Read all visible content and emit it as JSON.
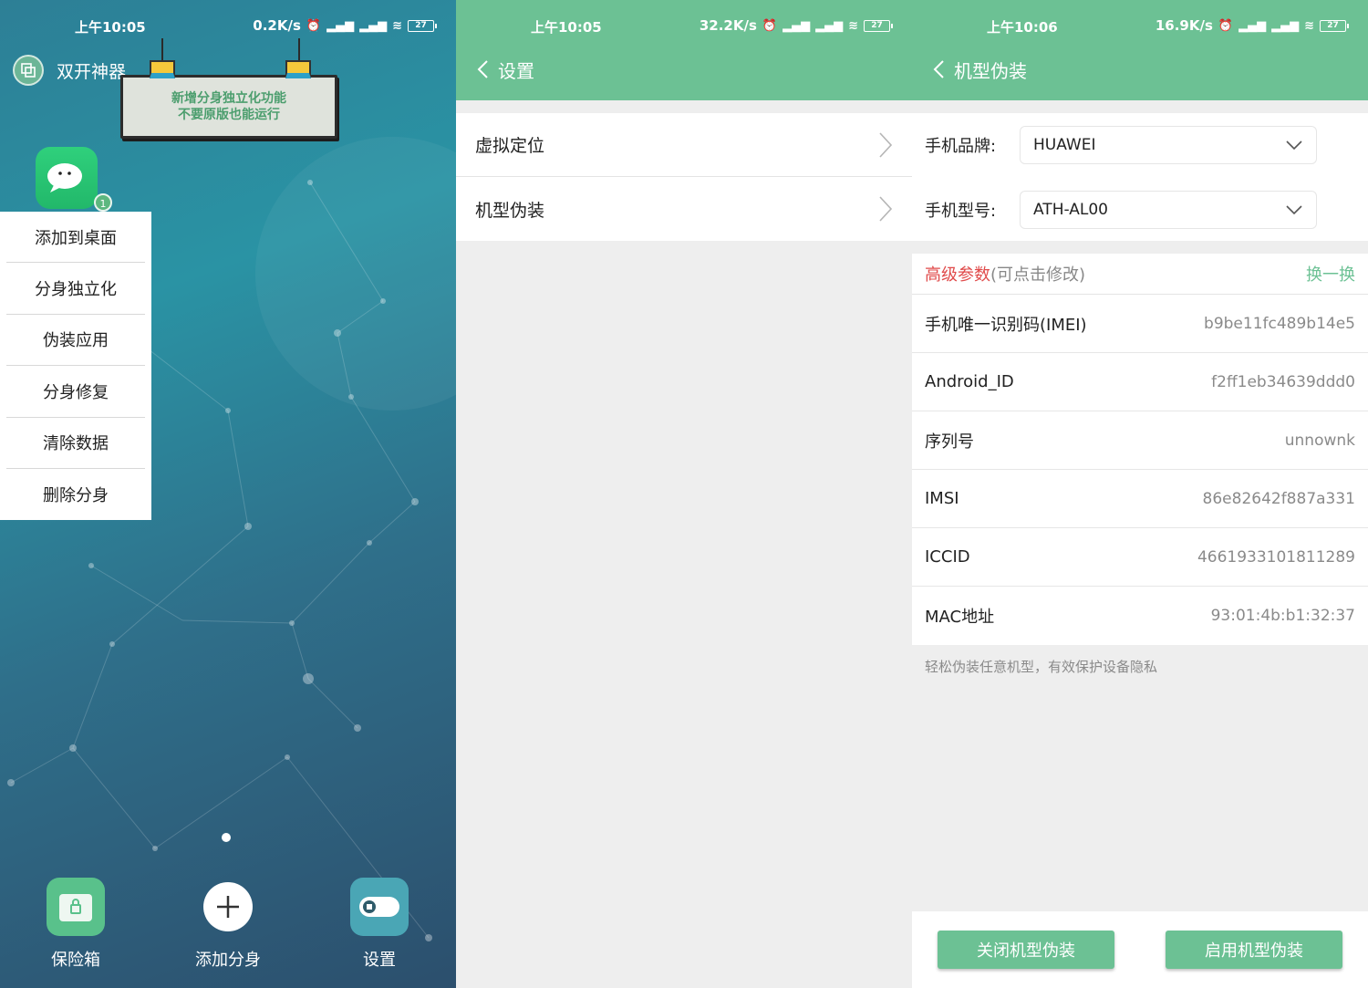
{
  "panel_home": {
    "status": {
      "time": "上午10:05",
      "net_speed": "0.2K/s",
      "battery": "27"
    },
    "brand": "双开神器",
    "banner": {
      "line1": "新增分身独立化功能",
      "line2": "不要原版也能运行"
    },
    "app_badge": "1",
    "context_menu": [
      "添加到桌面",
      "分身独立化",
      "伪装应用",
      "分身修复",
      "清除数据",
      "删除分身"
    ],
    "dock": [
      {
        "label": "保险箱",
        "icon": "lock-icon",
        "color": "#59c18b"
      },
      {
        "label": "添加分身",
        "icon": "plus-icon",
        "color": "#ffffff"
      },
      {
        "label": "设置",
        "icon": "toggle-icon",
        "color": "#4aa6b5"
      }
    ]
  },
  "panel_settings": {
    "status": {
      "time": "上午10:05",
      "net_speed": "32.2K/s",
      "battery": "27"
    },
    "title": "设置",
    "items": [
      "虚拟定位",
      "机型伪装"
    ]
  },
  "panel_device": {
    "status": {
      "time": "上午10:06",
      "net_speed": "16.9K/s",
      "battery": "27"
    },
    "title": "机型伪装",
    "brand_label": "手机品牌:",
    "brand_value": "HUAWEI",
    "model_label": "手机型号:",
    "model_value": "ATH-AL00",
    "adv_title": "高级参数",
    "adv_hint": "(可点击修改)",
    "adv_action": "换一换",
    "params": [
      {
        "label": "手机唯一识别码(IMEI)",
        "value": "b9be11fc489b14e5"
      },
      {
        "label": "Android_ID",
        "value": "f2ff1eb34639ddd0"
      },
      {
        "label": "序列号",
        "value": "unnownk"
      },
      {
        "label": "IMSI",
        "value": "86e82642f887a331"
      },
      {
        "label": "ICCID",
        "value": "4661933101811289"
      },
      {
        "label": "MAC地址",
        "value": "93:01:4b:b1:32:37"
      }
    ],
    "footnote": "轻松伪装任意机型，有效保护设备隐私",
    "btn_disable": "关闭机型伪装",
    "btn_enable": "启用机型伪装"
  },
  "colors": {
    "accent": "#6cc194",
    "warning": "#e04b4b"
  }
}
